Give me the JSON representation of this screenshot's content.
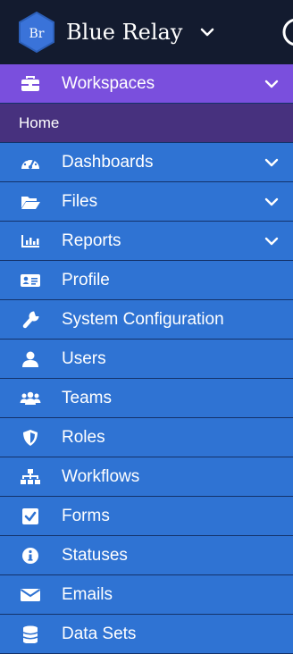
{
  "header": {
    "logo_text": "Br",
    "app_name": "Blue Relay",
    "switcher_icon": "chevron-down-icon"
  },
  "colors": {
    "header_bg": "#131b2f",
    "nav_bg": "#2f73d3",
    "active_section_bg": "#7a4fdd",
    "active_item_bg": "#47317e",
    "logo_blue": "#3a73d9"
  },
  "nav": {
    "items": [
      {
        "label": "Workspaces",
        "icon": "briefcase-icon",
        "expandable": true
      },
      {
        "label": "Home"
      },
      {
        "label": "Dashboards",
        "icon": "gauge-icon",
        "expandable": true
      },
      {
        "label": "Files",
        "icon": "folder-open-icon",
        "expandable": true
      },
      {
        "label": "Reports",
        "icon": "bar-chart-icon",
        "expandable": true
      },
      {
        "label": "Profile",
        "icon": "id-card-icon"
      },
      {
        "label": "System Configuration",
        "icon": "wrench-icon"
      },
      {
        "label": "Users",
        "icon": "user-icon"
      },
      {
        "label": "Teams",
        "icon": "users-icon"
      },
      {
        "label": "Roles",
        "icon": "shield-icon"
      },
      {
        "label": "Workflows",
        "icon": "sitemap-icon"
      },
      {
        "label": "Forms",
        "icon": "check-square-icon"
      },
      {
        "label": "Statuses",
        "icon": "info-circle-icon"
      },
      {
        "label": "Emails",
        "icon": "envelope-icon"
      },
      {
        "label": "Data Sets",
        "icon": "database-icon"
      }
    ]
  }
}
